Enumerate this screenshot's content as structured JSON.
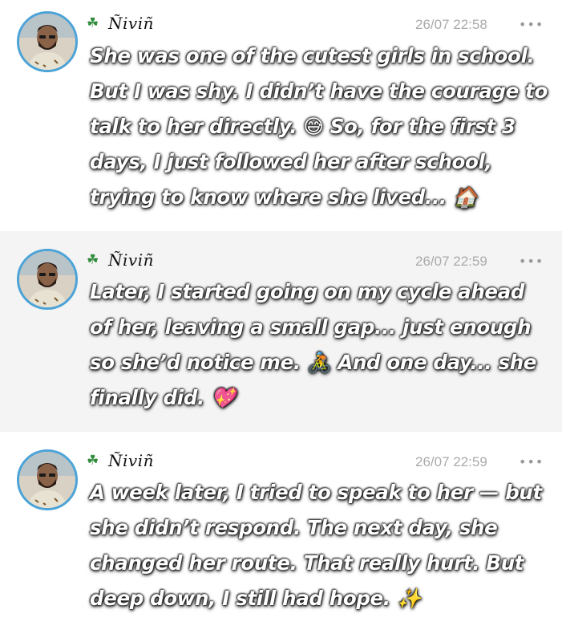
{
  "posts": [
    {
      "username": "Ñiviñ",
      "badge_icon": "four-leaf-clover-icon",
      "timestamp": "26/07 22:58",
      "more_label": "•••",
      "lines": [
        "She was one of the cutest girls in school.",
        "But I was shy. I didn’t have the courage to",
        "talk to her directly. 😅 So, for the first 3",
        "days, I just followed her after school,",
        "trying to know where she lived... 🏠"
      ]
    },
    {
      "username": "Ñiviñ",
      "badge_icon": "four-leaf-clover-icon",
      "timestamp": "26/07 22:59",
      "more_label": "•••",
      "lines": [
        "Later, I started going on my cycle ahead",
        "of her, leaving a small gap... just enough",
        "so she’d notice me. 🚴 And one day... she",
        "finally did. 💖"
      ]
    },
    {
      "username": "Ñiviñ",
      "badge_icon": "four-leaf-clover-icon",
      "timestamp": "26/07 22:59",
      "more_label": "•••",
      "lines": [
        "A week later, I tried to speak to her — but",
        "she didn’t respond. The next day, she",
        "changed her route. That really hurt. But",
        "deep down, I still had hope. ✨"
      ]
    }
  ],
  "colors": {
    "avatar_ring": "#4ba3d8",
    "timestamp": "#aaaaaa",
    "shaded_background": "#f4f4f4",
    "clover": "#2e8b3a"
  }
}
